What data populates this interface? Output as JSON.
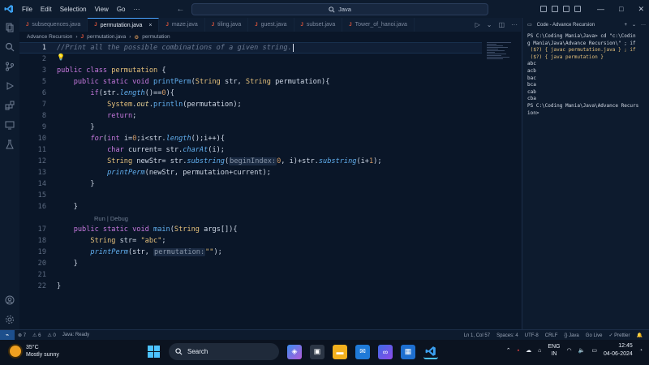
{
  "titlebar": {
    "menus": [
      "File",
      "Edit",
      "Selection",
      "View",
      "Go"
    ],
    "more": "···",
    "search": "Java",
    "back_glyph": "←",
    "forward_glyph": "→"
  },
  "tabs": [
    {
      "label": "subsequences.java",
      "active": false
    },
    {
      "label": "permutation.java",
      "active": true,
      "close": "×"
    },
    {
      "label": "maze.java",
      "active": false
    },
    {
      "label": "tiling.java",
      "active": false
    },
    {
      "label": "guest.java",
      "active": false
    },
    {
      "label": "subset.java",
      "active": false
    },
    {
      "label": "Tower_of_hanoi.java",
      "active": false
    }
  ],
  "breadcrumb": {
    "folder": "Advance Recursion",
    "file": "permutation.java",
    "symbol": "permutation",
    "sep": "›"
  },
  "editor": {
    "line_numbers": [
      "1",
      "2",
      "3",
      "4",
      "5",
      "6",
      "7",
      "8",
      "9",
      "10",
      "11",
      "12",
      "13",
      "14",
      "15",
      "16",
      "17",
      "18",
      "19",
      "20",
      "21",
      "22"
    ],
    "codelens": "Run | Debug"
  },
  "panel": {
    "title": "Code - Advance Recursion",
    "terminal_lines": [
      "PS C:\\Coding Mania\\Java> cd \"c:\\Codin",
      "g Mania\\Java\\Advance Recursion\\\" ; if",
      " ($?) { javac permutation.java } ; if",
      " ($?) { java permutation }",
      "abc",
      "acb",
      "bac",
      "bca",
      "cab",
      "cba",
      "PS C:\\Coding Mania\\Java\\Advance Recurs",
      "ion>"
    ]
  },
  "statusbar": {
    "errors": "⊗ 7",
    "warnings": "⚠ 6",
    "info": "⚠ 0",
    "java": "Java: Ready",
    "position": "Ln 1, Col 57",
    "spaces": "Spaces: 4",
    "encoding": "UTF-8",
    "eol": "CRLF",
    "language": "{} Java",
    "golive": "Go Live",
    "prettier": "✓ Prettier"
  },
  "taskbar": {
    "temperature": "35°C",
    "weather": "Mostly sunny",
    "search": "Search",
    "lang_top": "ENG",
    "lang_bottom": "IN",
    "time": "12:45",
    "date": "04-06-2024"
  },
  "colors": {
    "accent": "#4aa3ff",
    "keyword": "#c678dd",
    "function": "#61afef",
    "type": "#e5c07b"
  }
}
